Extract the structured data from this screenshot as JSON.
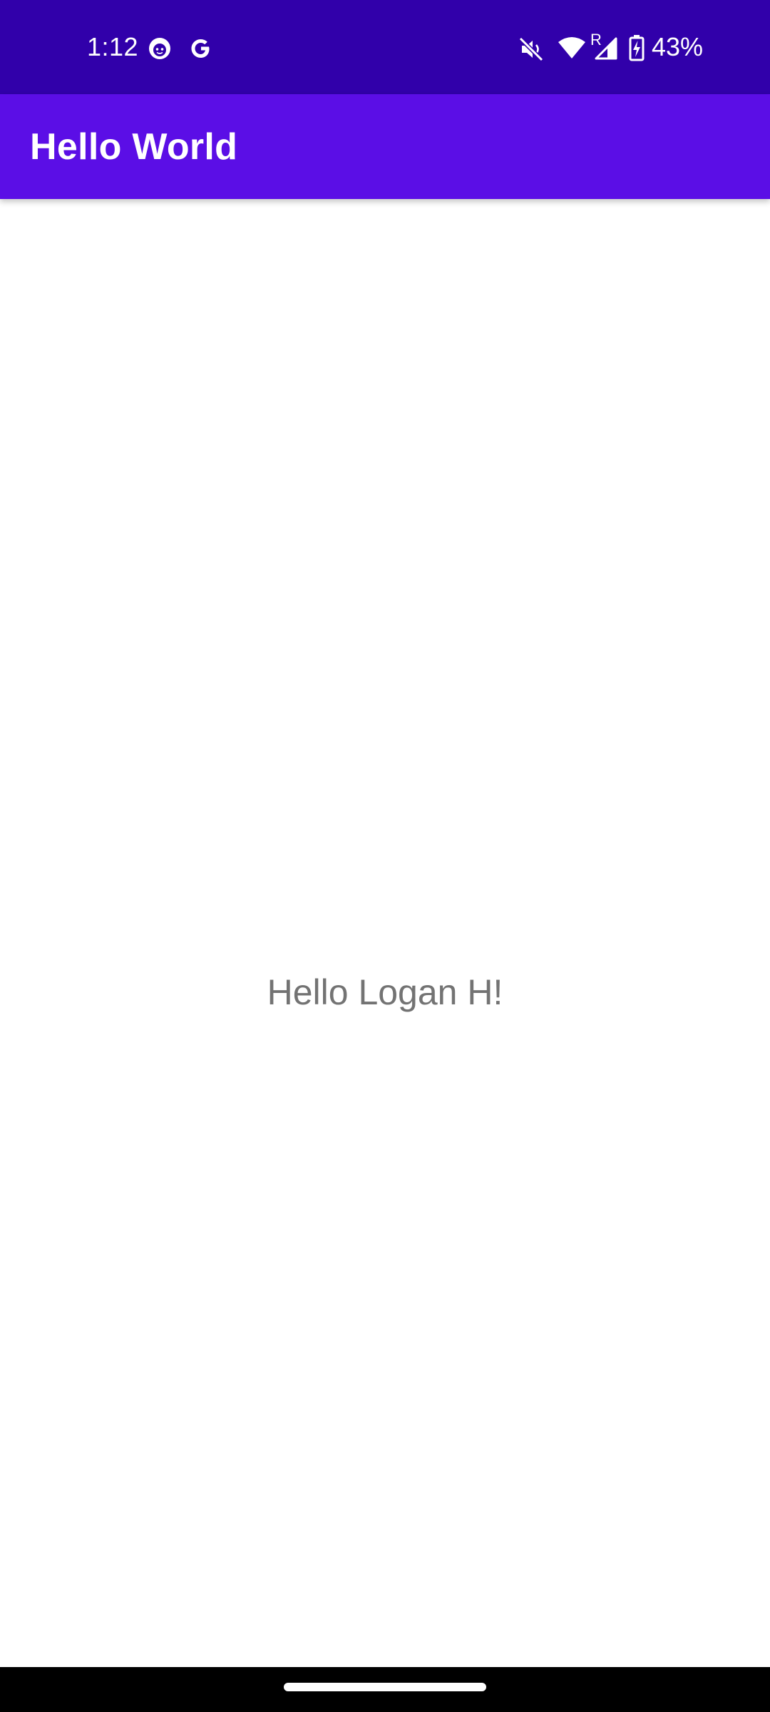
{
  "status_bar": {
    "time": "1:12",
    "battery_percent": "43%",
    "signal_roaming_label": "R",
    "icons": [
      "face-notification-icon",
      "google-g-icon",
      "mute-icon",
      "wifi-icon",
      "cell-signal-icon",
      "battery-charging-icon"
    ],
    "background_color": "#3100AA"
  },
  "app_bar": {
    "title": "Hello World",
    "background_color": "#5B0EE6"
  },
  "main": {
    "greeting": "Hello Logan H!"
  },
  "nav_bar": {
    "background_color": "#000000"
  }
}
